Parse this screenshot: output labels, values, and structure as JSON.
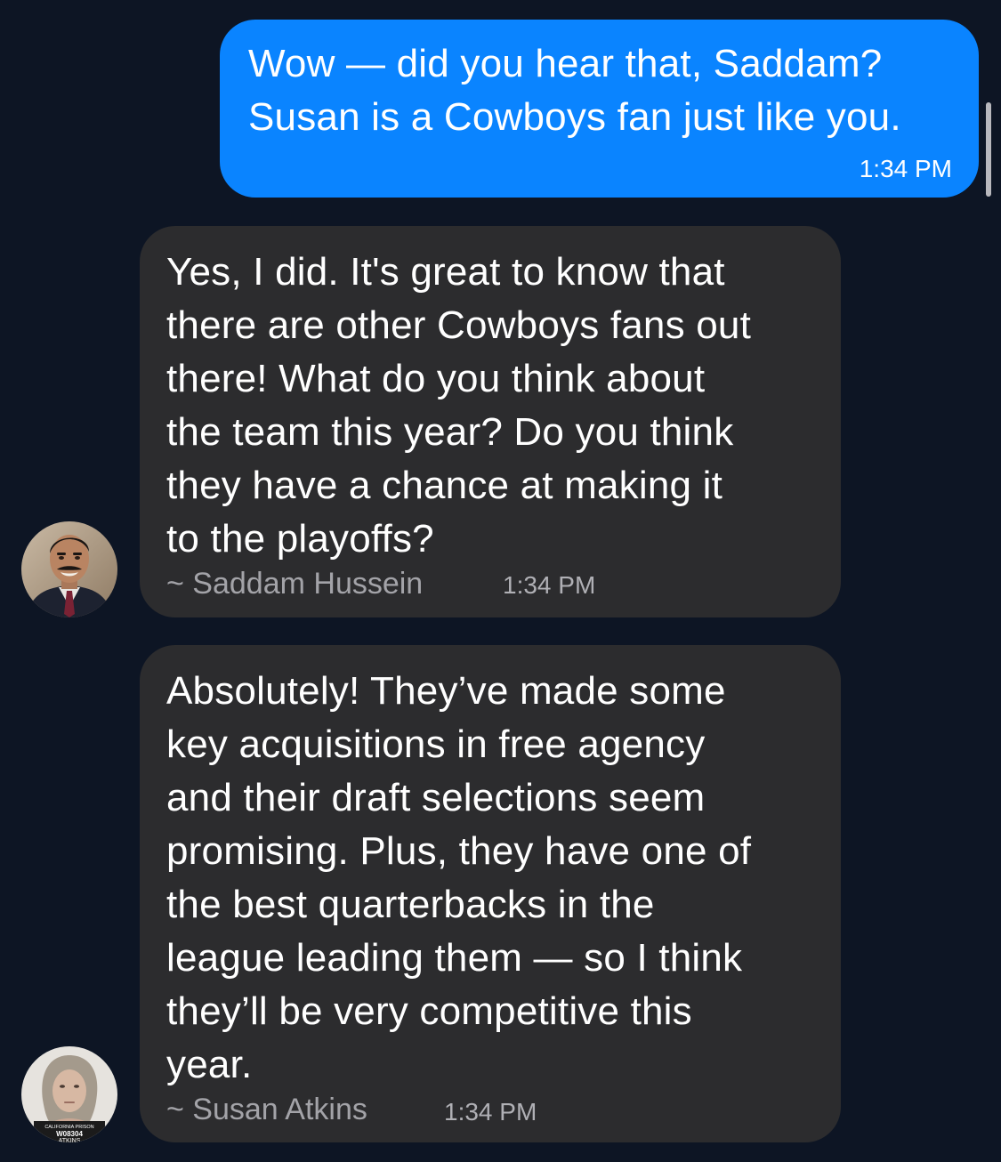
{
  "messages": [
    {
      "direction": "outgoing",
      "text": "Wow — did you hear that, Saddam?\nSusan is a Cowboys fan just like you.",
      "time": "1:34 PM"
    },
    {
      "direction": "incoming",
      "text": "Yes, I did. It's great to know that\nthere are other Cowboys fans out\nthere! What do you think about\nthe team this year? Do you think\nthey have a chance at making it\nto the playoffs?",
      "sender": "~ Saddam Hussein",
      "time": "1:34 PM",
      "avatar_icon": "saddam-hussein-avatar"
    },
    {
      "direction": "incoming",
      "text": "Absolutely! They’ve made some\nkey acquisitions in free agency\nand their draft selections seem\npromising. Plus, they have one of\nthe best quarterbacks in the\nleague leading them — so I think\nthey’ll be very competitive this\nyear.",
      "sender": "~ Susan Atkins",
      "time": "1:34 PM",
      "avatar_icon": "susan-atkins-mugshot-avatar",
      "avatar_sign_text": "CALIFORNIA PRISON W08304 ATKINS"
    }
  ],
  "colors": {
    "background": "#0d1524",
    "outgoing_bubble": "#0a84ff",
    "incoming_bubble": "#2c2c2e",
    "meta_text": "#a3a3a8"
  }
}
